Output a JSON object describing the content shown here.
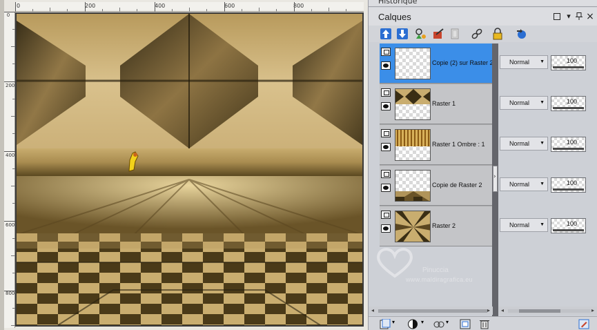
{
  "canvas": {
    "ruler_top_labels": [
      "0",
      "200",
      "400",
      "600",
      "800"
    ],
    "ruler_left_labels": [
      "0",
      "200",
      "400",
      "600",
      "800"
    ]
  },
  "panel": {
    "history_tab_label": "Historique",
    "title": "Calques",
    "header_buttons": [
      "restore-window-icon",
      "dropdown-arrow-icon",
      "pin-icon",
      "close-icon"
    ],
    "toolbar_icons": [
      "move-layer-up-icon",
      "move-layer-down-icon",
      "new-raster-layer-icon",
      "new-vector-layer-icon",
      "new-mask-layer-icon",
      "link-layers-icon",
      "lock-transparency-icon",
      "duplicate-layer-icon"
    ],
    "layers": [
      {
        "name": "Copie (2) sur Raster 2",
        "blend": "Normal",
        "opacity": "100",
        "selected": true,
        "thumb": "empty"
      },
      {
        "name": "Raster 1",
        "blend": "Normal",
        "opacity": "100",
        "selected": false,
        "thumb": "diamonds"
      },
      {
        "name": "Raster 1 Ombre : 1",
        "blend": "Normal",
        "opacity": "100",
        "selected": false,
        "thumb": "stripes"
      },
      {
        "name": "Copie de Raster 2",
        "blend": "Normal",
        "opacity": "100",
        "selected": false,
        "thumb": "floor"
      },
      {
        "name": "Raster 2",
        "blend": "Normal",
        "opacity": "100",
        "selected": false,
        "thumb": "radial"
      }
    ],
    "watermark": {
      "line1": "Pinuccia",
      "line2": "www.maldiragrafica.eu"
    },
    "bottom_toolbar_icons": [
      "new-layer-group-icon",
      "mask-icon",
      "adjustment-layer-icon",
      "merge-icon",
      "delete-layer-icon",
      "edit-icon"
    ],
    "colors": {
      "selected_row": "#3b8ee8",
      "row_bg": "#c4c5c8",
      "splitter": "#64656b",
      "panel_bg": "#cdd0d6"
    }
  }
}
